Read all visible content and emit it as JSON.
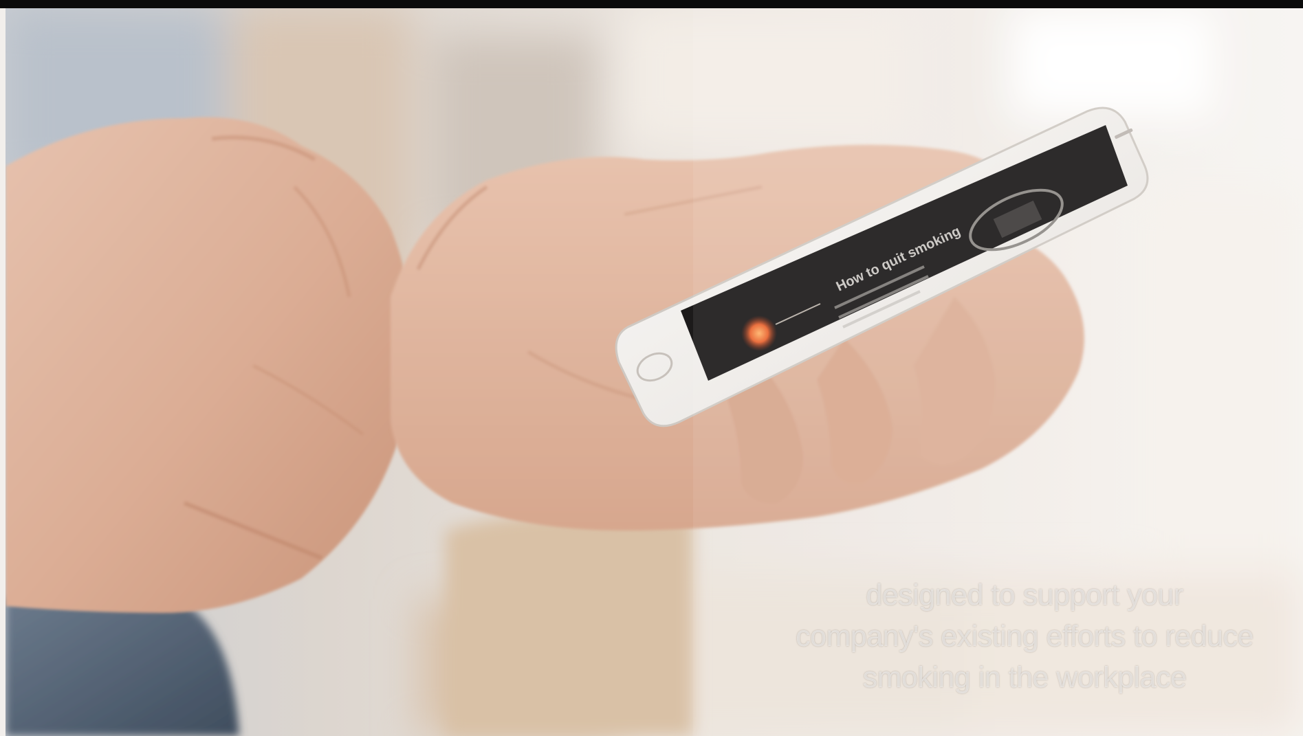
{
  "caption": {
    "line1": "designed to support your",
    "line2": "company's existing efforts to reduce",
    "line3": "smoking in the workplace"
  },
  "colors": {
    "skin": "#e3bba4",
    "skin_shadow": "#c9957c",
    "phone_body": "#f4f1ee",
    "phone_screen": "#1c1a1a",
    "accent_orange": "#e0542c",
    "sleeve": "#5a6b7f",
    "background": "#f2efec"
  },
  "phone_screen_text": {
    "heading": "How to quit smoking"
  }
}
